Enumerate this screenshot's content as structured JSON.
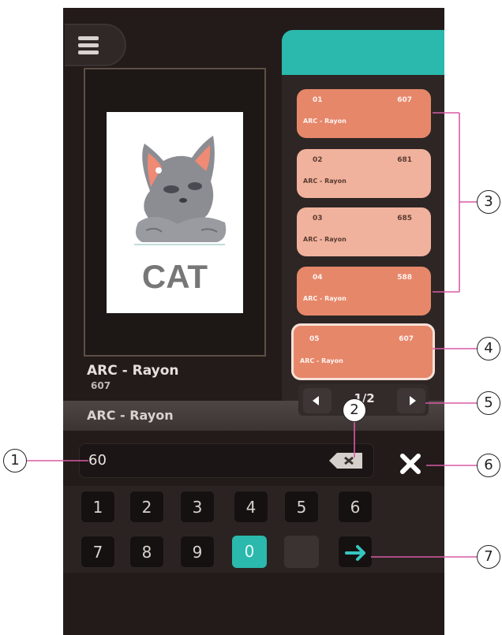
{
  "preview": {
    "card_label": "CAT"
  },
  "current_thread": {
    "brand": "ARC - Rayon",
    "code": "607"
  },
  "name_bar": {
    "text": "ARC - Rayon"
  },
  "threads": [
    {
      "num": "01",
      "code": "607",
      "brand": "ARC - Rayon",
      "style": "orange"
    },
    {
      "num": "02",
      "code": "681",
      "brand": "ARC - Rayon",
      "style": "light"
    },
    {
      "num": "03",
      "code": "685",
      "brand": "ARC - Rayon",
      "style": "light"
    },
    {
      "num": "04",
      "code": "588",
      "brand": "ARC - Rayon",
      "style": "orange"
    },
    {
      "num": "05",
      "code": "607",
      "brand": "ARC - Rayon",
      "style": "selected"
    }
  ],
  "pager": {
    "text": "1/2"
  },
  "input": {
    "value": "60"
  },
  "keypad": {
    "row1": [
      "1",
      "2",
      "3",
      "4",
      "5",
      "6"
    ],
    "row2": [
      "7",
      "8",
      "9",
      "0"
    ]
  },
  "callouts": [
    "1",
    "2",
    "3",
    "4",
    "5",
    "6",
    "7"
  ],
  "icons": {
    "menu": "menu-icon",
    "backspace": "backspace-icon",
    "close": "close-icon",
    "prev": "chevron-left-icon",
    "next": "chevron-right-icon",
    "enter": "arrow-right-icon"
  },
  "colors": {
    "accent": "#2ab9ac",
    "thread_orange": "#e6876a",
    "thread_light": "#f0b29c",
    "background": "#231b1a"
  }
}
